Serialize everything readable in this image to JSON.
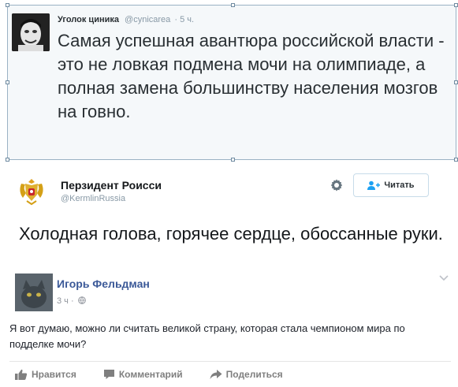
{
  "tweet1": {
    "name": "Уголок циника",
    "handle": "@cynicarea",
    "time": "· 5 ч.",
    "text": "Самая успешная авантюра российской власти - это не ловкая подмена мочи на олимпиаде, а полная замена большинству населения мозгов на говно."
  },
  "tweet2": {
    "name": "Перзидент Роисси",
    "handle": "@KermlinRussia",
    "follow_label": "Читать",
    "text": "Холодная голова, горячее сердце, обоссанные руки."
  },
  "fb_comment": {
    "name": "Игорь Фельдман",
    "time": "3 ч ·",
    "text": "Я вот думаю, можно ли считать великой страну, которая стала чемпионом мира по подделке мочи?",
    "actions": {
      "like": "Нравится",
      "comment": "Комментарий",
      "share": "Поделиться"
    }
  },
  "colors": {
    "twitter_meta": "#8899a6",
    "fb_name": "#3b5998",
    "fb_action": "#7f7f7f",
    "selection_border": "#9ab2c4"
  },
  "icons": {
    "gear": "gear-icon",
    "follow": "add-user-icon",
    "globe": "globe-icon",
    "chevron": "chevron-down-icon",
    "like": "thumbs-up-icon",
    "comment": "comment-icon",
    "share": "share-arrow-icon"
  }
}
